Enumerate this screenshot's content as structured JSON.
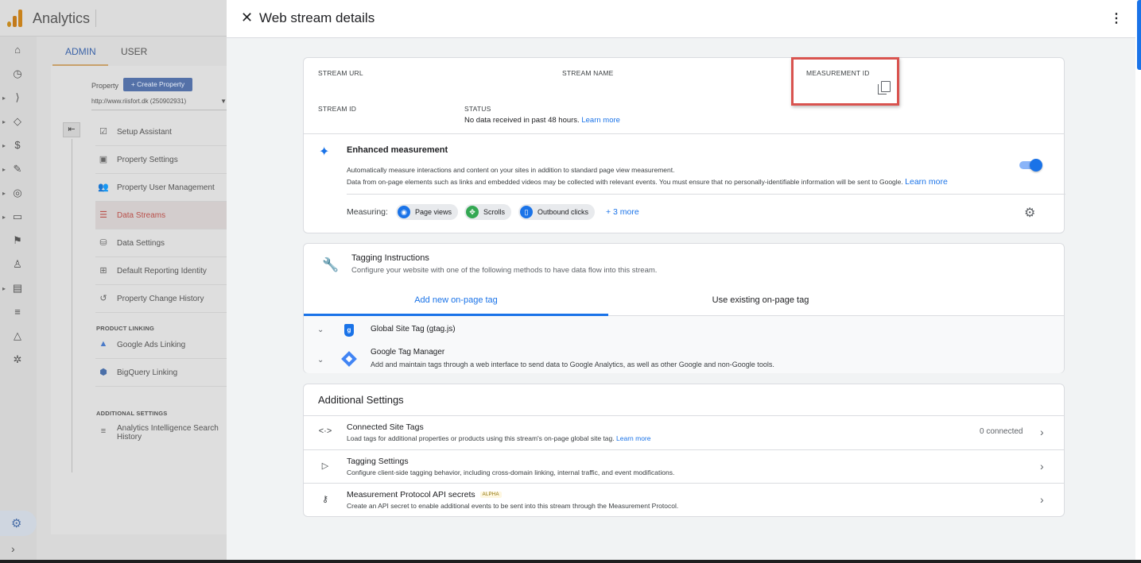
{
  "app": {
    "title": "Analytics",
    "tabs": {
      "admin": "ADMIN",
      "user": "USER"
    },
    "property_label": "Property",
    "create_property": "+ Create Property",
    "property_select": "http://www.riisfort.dk (250902931)",
    "nav": [
      {
        "label": "Setup Assistant",
        "icon": "checkbox-icon"
      },
      {
        "label": "Property Settings",
        "icon": "settings-page-icon"
      },
      {
        "label": "Property User Management",
        "icon": "people-icon"
      },
      {
        "label": "Data Streams",
        "icon": "streams-icon",
        "active": true
      },
      {
        "label": "Data Settings",
        "icon": "database-icon"
      },
      {
        "label": "Default Reporting Identity",
        "icon": "identity-icon"
      },
      {
        "label": "Property Change History",
        "icon": "history-icon"
      }
    ],
    "product_linking_heading": "PRODUCT LINKING",
    "product_links": [
      {
        "label": "Google Ads Linking",
        "icon": "google-ads-icon"
      },
      {
        "label": "BigQuery Linking",
        "icon": "bigquery-icon"
      }
    ],
    "additional_heading": "ADDITIONAL SETTINGS",
    "additional_links": [
      {
        "label": "Analytics Intelligence Search History",
        "icon": "search-history-icon"
      }
    ]
  },
  "drawer": {
    "title": "Web stream details",
    "stream_details": {
      "stream_url_label": "STREAM URL",
      "stream_name_label": "STREAM NAME",
      "measurement_id_label": "MEASUREMENT ID",
      "stream_id_label": "STREAM ID",
      "status_label": "STATUS",
      "status_text": "No data received in past 48 hours.",
      "status_link": "Learn more"
    },
    "enhanced": {
      "title": "Enhanced measurement",
      "desc1": "Automatically measure interactions and content on your sites in addition to standard page view measurement.",
      "desc2": "Data from on-page elements such as links and embedded videos may be collected with relevant events. You must ensure that no personally-identifiable information will be sent to Google.",
      "desc2_link": "Learn more",
      "enabled": true,
      "measuring_label": "Measuring:",
      "chips": [
        {
          "label": "Page views",
          "color": "#1a73e8",
          "icon": "eye-icon"
        },
        {
          "label": "Scrolls",
          "color": "#34a853",
          "icon": "scroll-icon"
        },
        {
          "label": "Outbound clicks",
          "color": "#1a73e8",
          "icon": "mouse-icon"
        }
      ],
      "more": "+ 3 more"
    },
    "tagging": {
      "title": "Tagging Instructions",
      "subtitle": "Configure your website with one of the following methods to have data flow into this stream.",
      "tab_new": "Add new on-page tag",
      "tab_existing": "Use existing on-page tag",
      "options": [
        {
          "title": "Global Site Tag (gtag.js)",
          "subtitle": ""
        },
        {
          "title": "Google Tag Manager",
          "subtitle": "Add and maintain tags through a web interface to send data to Google Analytics, as well as other Google and non-Google tools."
        }
      ]
    },
    "additional": {
      "title": "Additional Settings",
      "rows": [
        {
          "title": "Connected Site Tags",
          "subtitle": "Load tags for additional properties or products using this stream's on-page global site tag.",
          "link": "Learn more",
          "meta": "0 connected",
          "icon": "code-icon"
        },
        {
          "title": "Tagging Settings",
          "subtitle": "Configure client-side tagging behavior, including cross-domain linking, internal traffic, and event modifications.",
          "icon": "label-icon"
        },
        {
          "title": "Measurement Protocol API secrets",
          "badge": "ALPHA",
          "subtitle": "Create an API secret to enable additional events to be sent into this stream through the Measurement Protocol.",
          "icon": "key-icon"
        }
      ]
    }
  },
  "colors": {
    "accent": "#1a73e8",
    "highlight": "#d9534f",
    "active_nav": "#b9504a"
  }
}
